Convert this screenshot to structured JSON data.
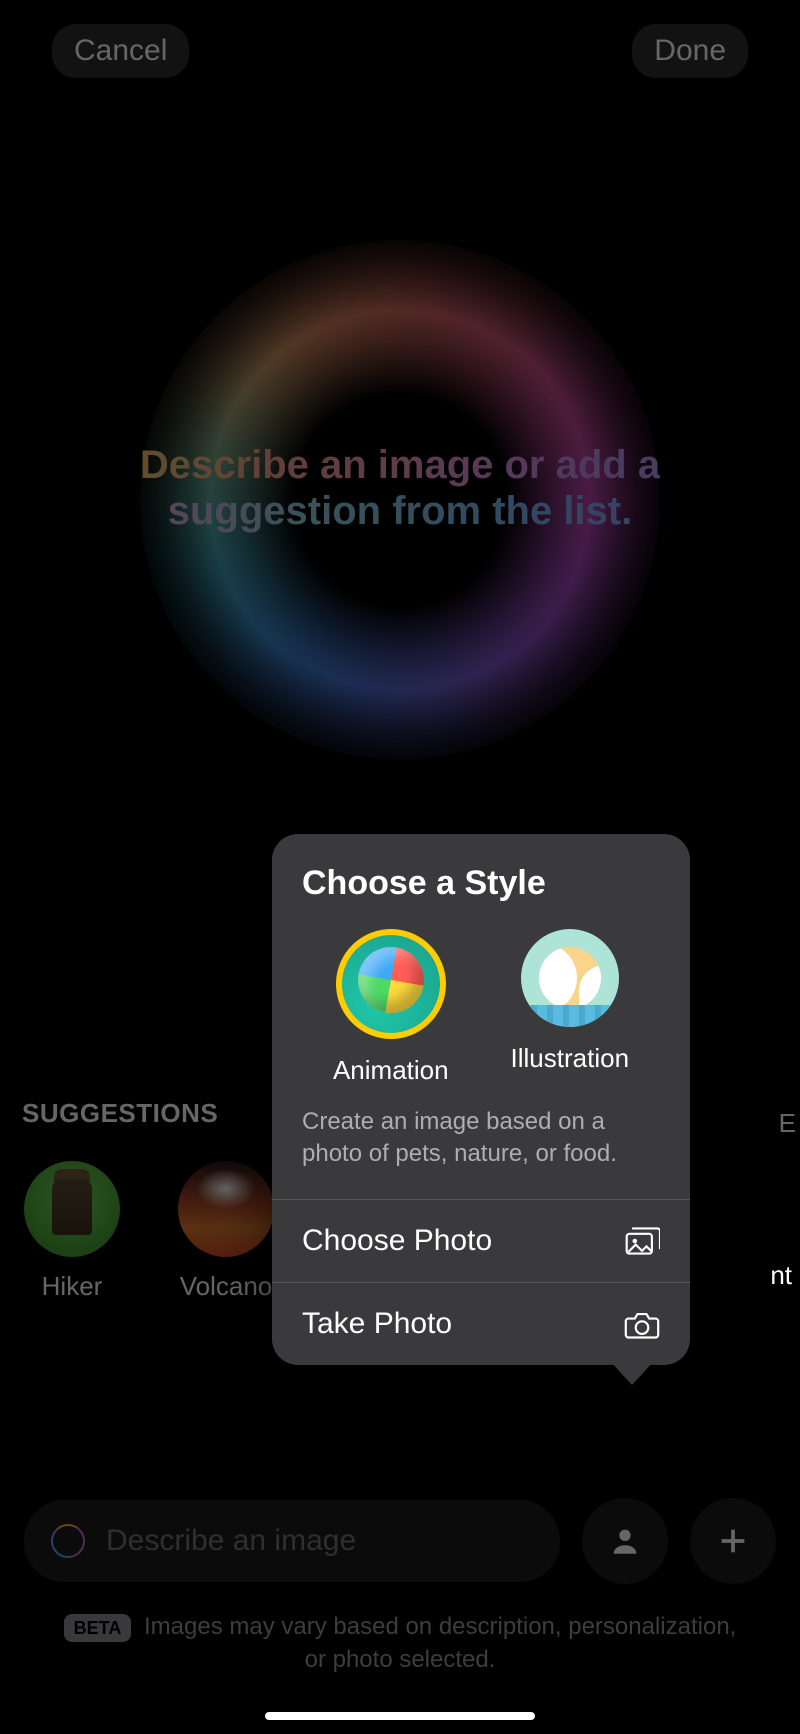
{
  "nav": {
    "cancel": "Cancel",
    "done": "Done"
  },
  "headline": {
    "line1": "Describe an image or add a",
    "line2": "suggestion from the list."
  },
  "suggestions": {
    "title": "SUGGESTIONS",
    "items": [
      {
        "label": "Hiker"
      },
      {
        "label": "Volcano"
      }
    ],
    "partial_right_letter": "E",
    "partial_right_tail": "nt"
  },
  "input": {
    "placeholder": "Describe an image"
  },
  "disclaimer": {
    "badge": "BETA",
    "text": "Images may vary based on description, personalization, or photo selected."
  },
  "popover": {
    "title": "Choose a Style",
    "styles": [
      {
        "label": "Animation",
        "selected": true
      },
      {
        "label": "Illustration",
        "selected": false
      }
    ],
    "description": "Create an image based on a photo of pets, nature, or food.",
    "choose_photo": "Choose Photo",
    "take_photo": "Take Photo"
  }
}
